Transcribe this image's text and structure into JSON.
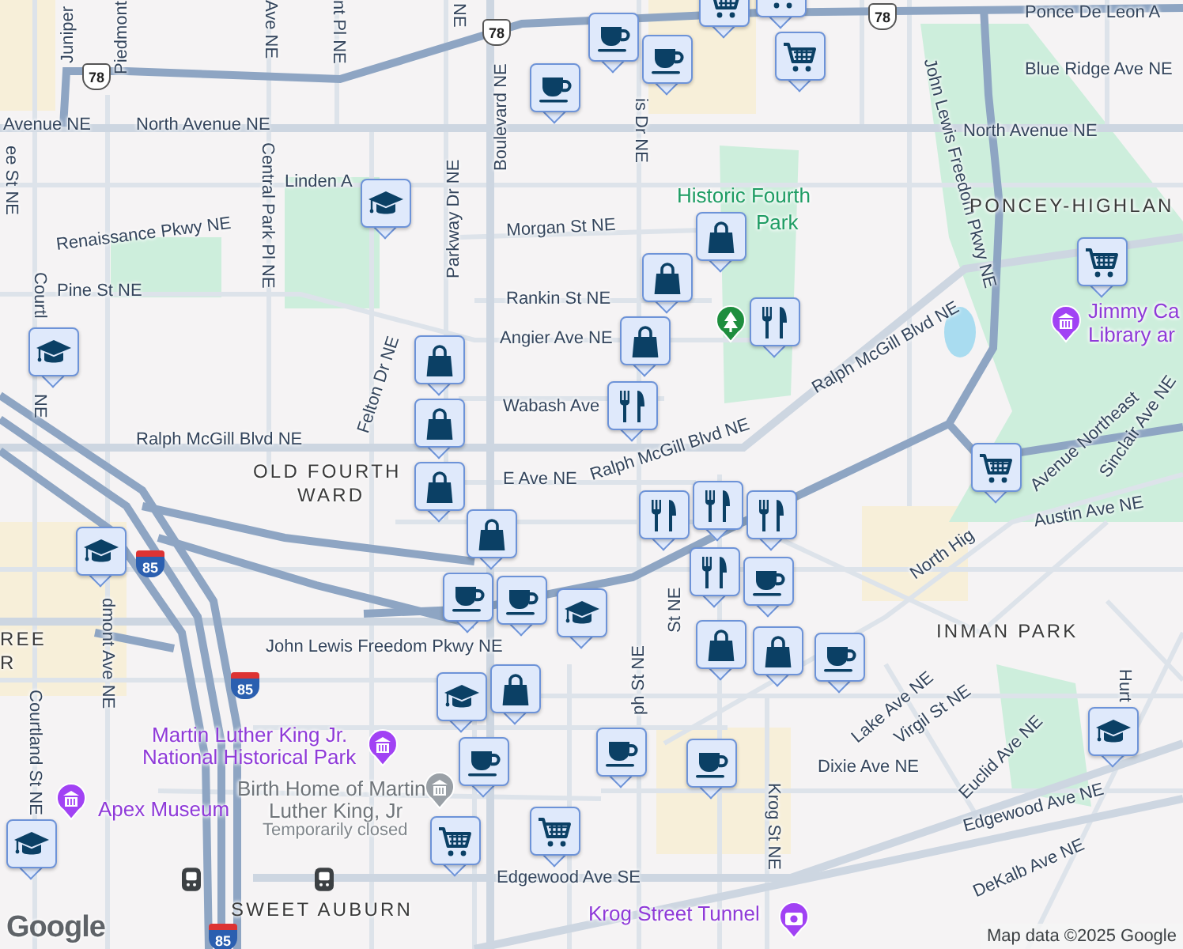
{
  "map": {
    "labels": [
      {
        "text": "Ponce De Leon A",
        "kind": "street"
      },
      {
        "text": "Blue Ridge Ave NE",
        "kind": "street"
      },
      {
        "text": "Avenue NE",
        "kind": "street"
      },
      {
        "text": "North Avenue NE",
        "kind": "street"
      },
      {
        "text": "North Avenue NE",
        "kind": "street"
      },
      {
        "text": "Linden A",
        "kind": "street"
      },
      {
        "text": "Renaissance Pkwy NE",
        "kind": "street"
      },
      {
        "text": "Morgan St NE",
        "kind": "street"
      },
      {
        "text": "Pine St NE",
        "kind": "street"
      },
      {
        "text": "Rankin St NE",
        "kind": "street"
      },
      {
        "text": "Angier Ave NE",
        "kind": "street"
      },
      {
        "text": "Wabash Ave",
        "kind": "street"
      },
      {
        "text": "Ralph McGill Blvd NE",
        "kind": "street"
      },
      {
        "text": "Ralph McGill Blvd NE",
        "kind": "street"
      },
      {
        "text": "Ralph McGill Blvd NE",
        "kind": "street"
      },
      {
        "text": "OLD FOURTH",
        "kind": "area"
      },
      {
        "text": "WARD",
        "kind": "area"
      },
      {
        "text": "E Ave NE",
        "kind": "street"
      },
      {
        "text": "is Dr NE",
        "kind": "street"
      },
      {
        "text": "Historic Fourth",
        "kind": "park"
      },
      {
        "text": "Park",
        "kind": "park"
      },
      {
        "text": "John Lewis Freedom Pkwy NE",
        "kind": "street"
      },
      {
        "text": "PONCEY-HIGHLAN",
        "kind": "area"
      },
      {
        "text": "Jimmy Ca",
        "kind": "place"
      },
      {
        "text": "Library ar",
        "kind": "place"
      },
      {
        "text": "North Hig",
        "kind": "street"
      },
      {
        "text": "Avenue Northeast",
        "kind": "street"
      },
      {
        "text": "Sinclair Ave NE",
        "kind": "street"
      },
      {
        "text": "Austin Ave NE",
        "kind": "street"
      },
      {
        "text": "INMAN PARK",
        "kind": "area"
      },
      {
        "text": "Lake Ave NE",
        "kind": "street"
      },
      {
        "text": "Virgil St NE",
        "kind": "street"
      },
      {
        "text": "Euclid Ave NE",
        "kind": "street"
      },
      {
        "text": "Edgewood Ave NE",
        "kind": "street"
      },
      {
        "text": "Hurt",
        "kind": "street"
      },
      {
        "text": "DeKalb Ave NE",
        "kind": "street"
      },
      {
        "text": "Dixie Ave NE",
        "kind": "street"
      },
      {
        "text": "Krog St NE",
        "kind": "street"
      },
      {
        "text": "John Lewis Freedom Pkwy NE",
        "kind": "street"
      },
      {
        "text": "Martin Luther King Jr.",
        "kind": "place"
      },
      {
        "text": "National Historical Park",
        "kind": "place"
      },
      {
        "text": "Birth Home of Martin",
        "kind": "closed"
      },
      {
        "text": "Luther King, Jr",
        "kind": "closed"
      },
      {
        "text": "Temporarily closed",
        "kind": "note"
      },
      {
        "text": "Apex Museum",
        "kind": "place"
      },
      {
        "text": "Edgewood Ave SE",
        "kind": "street"
      },
      {
        "text": "SWEET AUBURN",
        "kind": "area"
      },
      {
        "text": "Krog Street Tunnel",
        "kind": "place"
      },
      {
        "text": "Courtland St NE",
        "kind": "street"
      },
      {
        "text": "dmont Ave NE",
        "kind": "street"
      },
      {
        "text": "Central Park Pl NE",
        "kind": "street"
      },
      {
        "text": "Parkway Dr NE",
        "kind": "street"
      },
      {
        "text": "Boulevard NE",
        "kind": "street"
      },
      {
        "text": "Felton Dr NE",
        "kind": "street"
      },
      {
        "text": "Courtl",
        "kind": "street"
      },
      {
        "text": "NE",
        "kind": "street"
      },
      {
        "text": "REE",
        "kind": "area"
      },
      {
        "text": "R",
        "kind": "area"
      },
      {
        "text": "ph St NE",
        "kind": "street"
      },
      {
        "text": "St NE",
        "kind": "street"
      },
      {
        "text": "Juniper",
        "kind": "street"
      },
      {
        "text": "Piedmont",
        "kind": "street"
      },
      {
        "text": "Ave NE",
        "kind": "street"
      },
      {
        "text": "nt Pl NE",
        "kind": "street"
      },
      {
        "text": "NE",
        "kind": "street"
      },
      {
        "text": "ee St NE",
        "kind": "street"
      }
    ],
    "shields": [
      {
        "text": "78",
        "kind": "us"
      },
      {
        "text": "78",
        "kind": "us"
      },
      {
        "text": "78",
        "kind": "us"
      },
      {
        "text": "85",
        "kind": "interstate"
      },
      {
        "text": "85",
        "kind": "interstate"
      },
      {
        "text": "85",
        "kind": "interstate"
      }
    ],
    "pins": [
      {
        "kind": "park"
      },
      {
        "kind": "museum"
      },
      {
        "kind": "museum"
      },
      {
        "kind": "museum"
      },
      {
        "kind": "museum-closed"
      },
      {
        "kind": "camera"
      },
      {
        "kind": "transit"
      },
      {
        "kind": "transit"
      }
    ],
    "markers": [
      {
        "kind": "coffee"
      },
      {
        "kind": "coffee"
      },
      {
        "kind": "coffee"
      },
      {
        "kind": "grocery"
      },
      {
        "kind": "grocery"
      },
      {
        "kind": "grocery"
      },
      {
        "kind": "school"
      },
      {
        "kind": "school"
      },
      {
        "kind": "shopping"
      },
      {
        "kind": "shopping"
      },
      {
        "kind": "shopping"
      },
      {
        "kind": "restaurant"
      },
      {
        "kind": "grocery"
      },
      {
        "kind": "shopping"
      },
      {
        "kind": "shopping"
      },
      {
        "kind": "restaurant"
      },
      {
        "kind": "shopping"
      },
      {
        "kind": "grocery"
      },
      {
        "kind": "restaurant"
      },
      {
        "kind": "restaurant"
      },
      {
        "kind": "restaurant"
      },
      {
        "kind": "restaurant"
      },
      {
        "kind": "shopping"
      },
      {
        "kind": "coffee"
      },
      {
        "kind": "coffee"
      },
      {
        "kind": "school"
      },
      {
        "kind": "coffee"
      },
      {
        "kind": "shopping"
      },
      {
        "kind": "shopping"
      },
      {
        "kind": "school"
      },
      {
        "kind": "coffee"
      },
      {
        "kind": "shopping"
      },
      {
        "kind": "school"
      },
      {
        "kind": "coffee"
      },
      {
        "kind": "coffee"
      },
      {
        "kind": "coffee"
      },
      {
        "kind": "grocery"
      },
      {
        "kind": "grocery"
      },
      {
        "kind": "school"
      },
      {
        "kind": "school"
      }
    ]
  },
  "logo": "Google",
  "attribution": "Map data ©2025 Google"
}
